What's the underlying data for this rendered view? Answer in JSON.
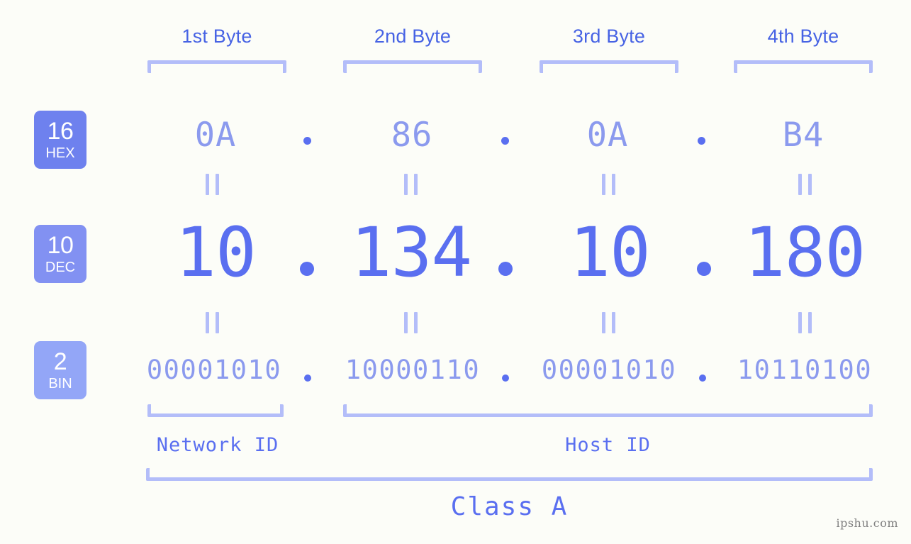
{
  "watermark": "ipshu.com",
  "byte_headers": [
    {
      "label": "1st Byte"
    },
    {
      "label": "2nd Byte"
    },
    {
      "label": "3rd Byte"
    },
    {
      "label": "4th Byte"
    }
  ],
  "rows": [
    {
      "badge_number": "16",
      "badge_name": "HEX",
      "badge_color": "#6e81ee",
      "values": [
        "0A",
        "86",
        "0A",
        "B4"
      ],
      "separator": "."
    },
    {
      "badge_number": "10",
      "badge_name": "DEC",
      "badge_color": "#8291f2",
      "values": [
        "10",
        "134",
        "10",
        "180"
      ],
      "separator": "."
    },
    {
      "badge_number": "2",
      "badge_name": "BIN",
      "badge_color": "#93a6f7",
      "values": [
        "00001010",
        "10000110",
        "00001010",
        "10110100"
      ],
      "separator": "."
    }
  ],
  "sections": [
    {
      "label": "Network ID"
    },
    {
      "label": "Host ID"
    }
  ],
  "class_label": "Class A",
  "colors": {
    "background": "#fcfdf8",
    "accent": "#5a6ff0",
    "accent_light": "#8b9aee",
    "bracket": "#b3bdf9",
    "header_text": "#4763e4",
    "watermark": "#808080"
  }
}
